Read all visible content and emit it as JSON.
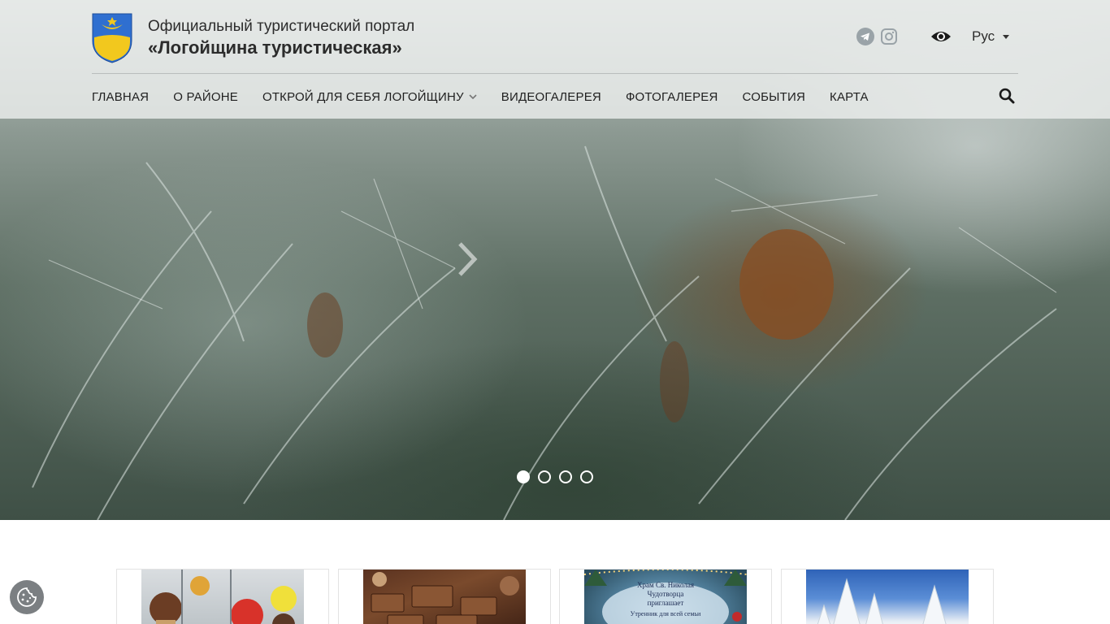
{
  "header": {
    "title_line1": "Официальный туристический портал",
    "title_line2": "«Логойщина туристическая»",
    "language": "Рус",
    "social": [
      "telegram-icon",
      "instagram-icon"
    ]
  },
  "nav": {
    "items": [
      {
        "label": "ГЛАВНАЯ"
      },
      {
        "label": "О РАЙОНЕ"
      },
      {
        "label": "ОТКРОЙ ДЛЯ СЕБЯ ЛОГОЙЩИНУ",
        "has_dropdown": true
      },
      {
        "label": "ВИДЕОГАЛЕРЕЯ"
      },
      {
        "label": "ФОТОГАЛЕРЕЯ"
      },
      {
        "label": "СОБЫТИЯ"
      },
      {
        "label": "КАРТА"
      }
    ]
  },
  "slider": {
    "slide_count": 4,
    "active_slide": 1
  },
  "cards": [
    {
      "thumb": "ice-cream-figures"
    },
    {
      "thumb": "chocolates"
    },
    {
      "thumb": "church-invitation",
      "text_lines": [
        "Храм Св. Николая",
        "Чудотворца",
        "приглашает",
        "Утренник для всей семьи"
      ]
    },
    {
      "thumb": "snowy-trees"
    }
  ],
  "colors": {
    "header_bg": "#eceeed",
    "text": "#1f1f1f",
    "logo_blue": "#2f6fd0",
    "logo_yellow": "#f2c81e"
  }
}
